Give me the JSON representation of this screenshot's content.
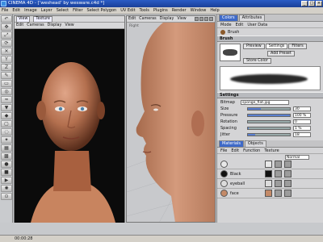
{
  "window": {
    "title": "CINEMA 4D - [‘weshead’ by wesware.c4d *]",
    "buttons": [
      "_",
      "□",
      "×"
    ]
  },
  "menubar": [
    "File",
    "Edit",
    "Image",
    "Layer",
    "Select",
    "Filter",
    "Select Polygon",
    "UV Edit",
    "Tools",
    "Plugins",
    "Render",
    "Window",
    "Help"
  ],
  "left_viewport": {
    "tabs": [
      "View",
      "Texture"
    ],
    "menu": [
      "Edit",
      "Cameras",
      "Display",
      "View"
    ]
  },
  "right_viewport": {
    "menu": [
      "Edit",
      "Cameras",
      "Display",
      "View"
    ],
    "label": "Right"
  },
  "panel": {
    "tabs": [
      "Colors",
      "Attributes"
    ],
    "active_tab": "Colors",
    "menu": [
      "Mode",
      "Edit",
      "User Data"
    ],
    "object_label": "Brush",
    "brush_section": "Brush",
    "brush_tabs": [
      "Preview",
      "Settings",
      "Filters"
    ],
    "active_brush_tab": "Settings",
    "brush_buttons": [
      "Add Preset",
      "Store Color"
    ],
    "settings_section": "Settings",
    "settings": {
      "bitmap_label": "Bitmap",
      "bitmap_value": "sponge_flat.jpg",
      "rows": [
        {
          "label": "Size",
          "value": "30",
          "fill": 0.3
        },
        {
          "label": "Pressure",
          "value": "100 %",
          "fill": 1.0
        },
        {
          "label": "Rotation",
          "value": "0",
          "fill": 0.0
        },
        {
          "label": "Spacing",
          "value": "1 %",
          "fill": 0.01
        },
        {
          "label": "Jitter",
          "value": "18",
          "fill": 0.18
        }
      ]
    }
  },
  "materials": {
    "tabs": [
      "Materials",
      "Objects"
    ],
    "menu": [
      "File",
      "Edit",
      "Function",
      "Texture"
    ],
    "mode": "Normal",
    "items": [
      {
        "name": "",
        "color": "#e8e8e8"
      },
      {
        "name": "Black",
        "color": "#111111"
      },
      {
        "name": "eyeball",
        "color": "#dcdcdc"
      },
      {
        "name": "face",
        "color": "#c48a68"
      }
    ]
  },
  "status": {
    "time": "00:00:28"
  },
  "colors": {
    "title_bar": "#1f4db3",
    "panel_bg": "#d4d4d6",
    "viewport_bg_left": "#111111",
    "viewport_bg_right": "#c8c9cc",
    "accent": "#3f6ac8"
  }
}
